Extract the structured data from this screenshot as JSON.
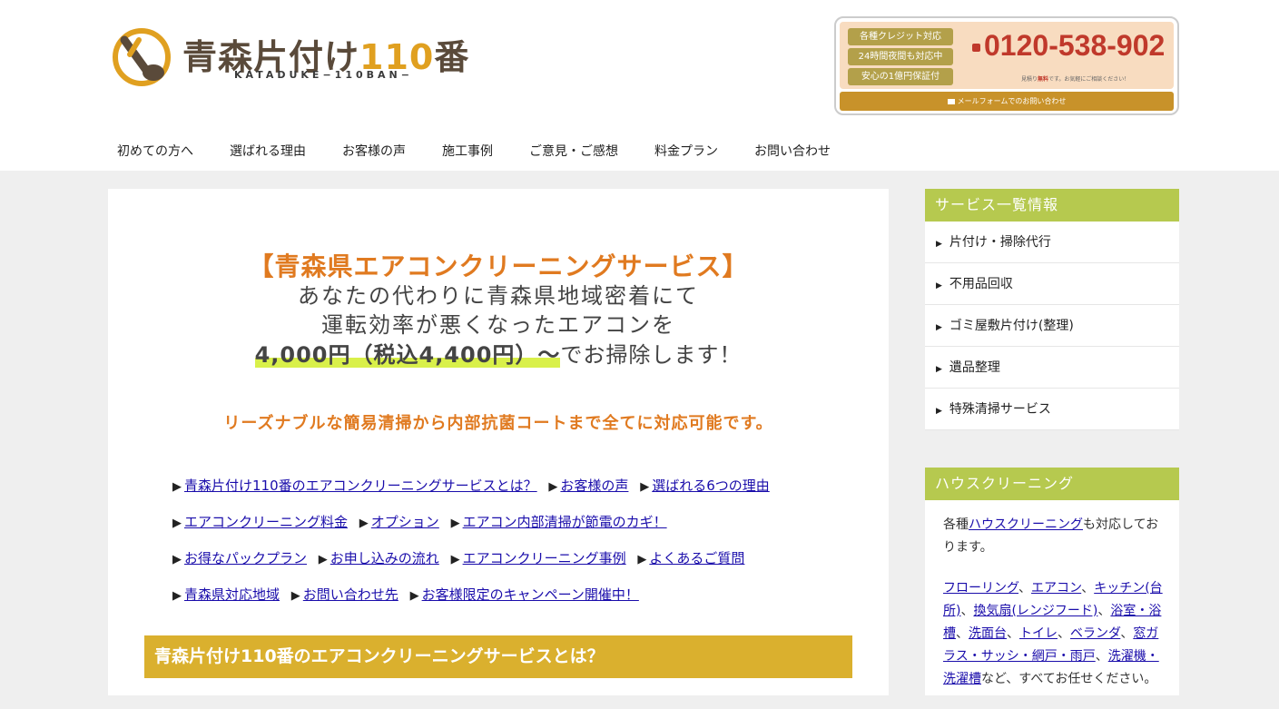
{
  "header": {
    "logo_title_a": "青森片付け",
    "logo_title_num": "110",
    "logo_title_b": "番",
    "logo_sub": "KATADUKE−110BAN−",
    "badges": [
      "各種クレジット対応",
      "24時間夜間も対応中",
      "安心の1億円保証付"
    ],
    "phone": "0120-538-902",
    "free_note_a": "見積り",
    "free_note_b": "無料",
    "free_note_c": "です。お気軽にご相談ください！",
    "mail_button": "メールフォームでのお問い合わせ"
  },
  "nav": [
    "初めての方へ",
    "選ばれる理由",
    "お客様の声",
    "施工事例",
    "ご意見・ご感想",
    "料金プラン",
    "お問い合わせ"
  ],
  "hero": {
    "title": "【青森県エアコンクリーニングサービス】",
    "line1": "あなたの代わりに青森県地域密着にて",
    "line2": "運転効率が悪くなったエアコンを",
    "price": "4,000円（税込4,400円）〜",
    "price_suffix": "でお掃除します！"
  },
  "catch": "リーズナブルな簡易清掃から内部抗菌コートまで全てに対応可能です。",
  "toc": [
    [
      "青森片付け110番のエアコンクリーニングサービスとは？",
      "お客様の声",
      "選ばれる6つの理由"
    ],
    [
      "エアコンクリーニング料金",
      "オプション",
      "エアコン内部清掃が節電のカギ！"
    ],
    [
      "お得なパックプラン",
      "お申し込みの流れ",
      "エアコンクリーニング事例",
      "よくあるご質問"
    ],
    [
      "青森県対応地域",
      "お問い合わせ先",
      "お客様限定のキャンペーン開催中！"
    ]
  ],
  "section_heading": "青森片付け110番のエアコンクリーニングサービスとは？",
  "sidebar": {
    "service_title": "サービス一覧情報",
    "services": [
      "片付け・掃除代行",
      "不用品回収",
      "ゴミ屋敷片付け(整理)",
      "遺品整理",
      "特殊清掃サービス"
    ],
    "house_title": "ハウスクリーニング",
    "house_text_a": "各種",
    "house_text_link": "ハウスクリーニング",
    "house_text_b": "も対応しております。",
    "house_links": [
      "フローリング",
      "エアコン",
      "キッチン(台所)",
      "換気扇(レンジフード)",
      "浴室・浴槽",
      "洗面台",
      "トイレ",
      "ベランダ",
      "窓ガラス・サッシ・網戸・雨戸",
      "洗濯機・洗濯槽"
    ],
    "house_tail": "など、すべてお任せください。"
  },
  "colors": {
    "accent_orange": "#e07a20",
    "gold": "#dab02e",
    "side_green": "#b6c94f",
    "phone_red": "#c0392b"
  }
}
